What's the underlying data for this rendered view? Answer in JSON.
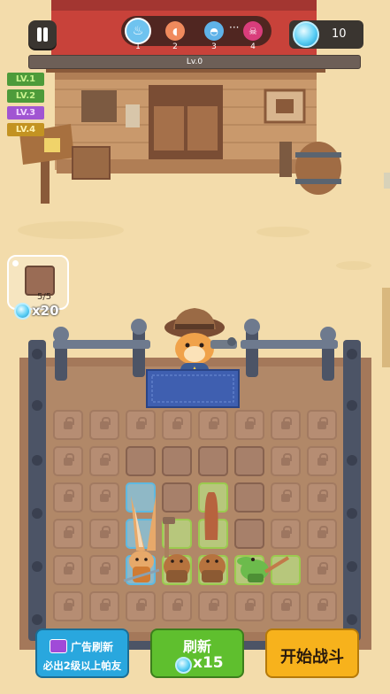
{
  "hud": {
    "stages": [
      {
        "num": "1",
        "icon": "pot-icon"
      },
      {
        "num": "2",
        "icon": "meat-icon"
      },
      {
        "num": "3",
        "icon": "helmet-icon"
      },
      {
        "num": "4",
        "icon": "skull-icon"
      }
    ],
    "stage_ellipsis": "···",
    "gems": "10",
    "level_label": "Lv.0"
  },
  "level_tags": [
    "LV.1",
    "LV.2",
    "LV.3",
    "LV.4"
  ],
  "tag_colors": {
    "lv1": "#3e8a33",
    "lv2": "#3e8a33",
    "lv3": "#9d4fc9",
    "lv4": "#b78a21"
  },
  "crate": {
    "count": "5/5",
    "cost": "x20"
  },
  "buttons": {
    "ad_refresh_title": "广告刷新",
    "ad_refresh_sub": "必出2级以上帕友",
    "refresh_label": "刷新",
    "refresh_cost": "x15",
    "start_label": "开始战斗"
  },
  "colors": {
    "blue_button": "#29a7de",
    "green_button": "#5fbf2e",
    "yellow_button": "#f7b21c",
    "wood": "#a9805e"
  }
}
